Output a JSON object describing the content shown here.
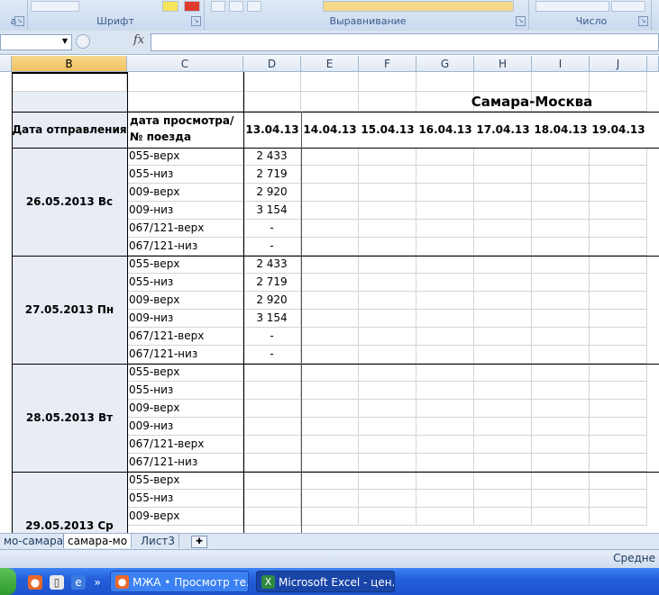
{
  "ribbon": {
    "group_labels": [
      "а",
      "Шрифт",
      "Выравнивание",
      "Число"
    ]
  },
  "formula_bar": {
    "fx_label": "fx",
    "name_value": "",
    "formula_value": ""
  },
  "columns": [
    "B",
    "C",
    "D",
    "E",
    "F",
    "G",
    "H",
    "I",
    "J"
  ],
  "sheet": {
    "route_title": "Самара-Москва",
    "header_departure": "Дата отправления",
    "header_view_line1": "дата просмотра/",
    "header_view_line2": "№ поезда",
    "view_dates": [
      "13.04.13",
      "14.04.13",
      "15.04.13",
      "16.04.13",
      "17.04.13",
      "18.04.13",
      "19.04.13"
    ],
    "blocks": [
      {
        "date": "26.05.2013 Вс",
        "rows": [
          {
            "train": "055-верх",
            "price": "2 433"
          },
          {
            "train": "055-низ",
            "price": "2 719"
          },
          {
            "train": "009-верх",
            "price": "2 920"
          },
          {
            "train": "009-низ",
            "price": "3 154"
          },
          {
            "train": "067/121-верх",
            "price": "-"
          },
          {
            "train": "067/121-низ",
            "price": "-"
          }
        ]
      },
      {
        "date": "27.05.2013 Пн",
        "rows": [
          {
            "train": "055-верх",
            "price": "2 433"
          },
          {
            "train": "055-низ",
            "price": "2 719"
          },
          {
            "train": "009-верх",
            "price": "2 920"
          },
          {
            "train": "009-низ",
            "price": "3 154"
          },
          {
            "train": "067/121-верх",
            "price": "-"
          },
          {
            "train": "067/121-низ",
            "price": "-"
          }
        ]
      },
      {
        "date": "28.05.2013 Вт",
        "rows": [
          {
            "train": "055-верх",
            "price": ""
          },
          {
            "train": "055-низ",
            "price": ""
          },
          {
            "train": "009-верх",
            "price": ""
          },
          {
            "train": "009-низ",
            "price": ""
          },
          {
            "train": "067/121-верх",
            "price": ""
          },
          {
            "train": "067/121-низ",
            "price": ""
          }
        ]
      },
      {
        "date": "29.05.2013 Ср",
        "rows": [
          {
            "train": "055-верх",
            "price": ""
          },
          {
            "train": "055-низ",
            "price": ""
          },
          {
            "train": "009-верх",
            "price": ""
          }
        ]
      }
    ]
  },
  "sheet_tabs": [
    "мо-самара",
    "самара-мо",
    "Лист3"
  ],
  "active_tab": "самара-мо",
  "status": {
    "text": "Средне"
  },
  "taskbar": {
    "items": [
      {
        "label": "МЖА • Просмотр те...",
        "icon": "firefox-icon"
      },
      {
        "label": "Microsoft Excel - цен...",
        "icon": "excel-icon"
      }
    ]
  },
  "colors": {
    "selected_header": "#f1c15f",
    "grid_line": "#d4d4d4",
    "date_block_fill": "#e8ecf5",
    "taskbar": "#245edb"
  }
}
